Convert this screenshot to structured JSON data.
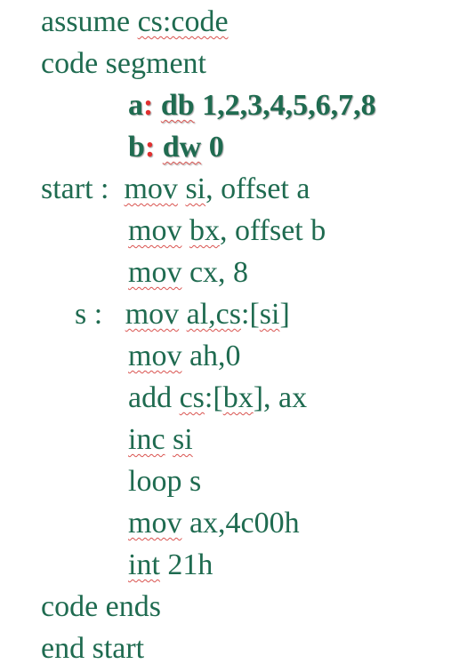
{
  "document": {
    "text_color": "#1f6b50",
    "accent_color": "#e03030",
    "spell_underline_color": "#d9534f",
    "lines": [
      {
        "indent": 46,
        "segments": [
          {
            "text": "assume "
          },
          {
            "text": "cs:code",
            "wavy": true
          }
        ]
      },
      {
        "indent": 46,
        "segments": [
          {
            "text": "code segment"
          }
        ]
      },
      {
        "indent": 144,
        "bold": true,
        "segments": [
          {
            "text": "a"
          },
          {
            "text": ":",
            "red": true
          },
          {
            "text": " "
          },
          {
            "text": "db",
            "wavy": true
          },
          {
            "text": " 1,2,3,4,5,6,7,8"
          }
        ]
      },
      {
        "indent": 144,
        "bold": true,
        "segments": [
          {
            "text": "b"
          },
          {
            "text": ":",
            "red": true
          },
          {
            "text": " "
          },
          {
            "text": "dw",
            "wavy": true
          },
          {
            "text": " 0"
          }
        ]
      },
      {
        "indent": 46,
        "segments": [
          {
            "text": "start :  "
          },
          {
            "text": "mov",
            "wavy": true
          },
          {
            "text": " "
          },
          {
            "text": "si",
            "wavy": true
          },
          {
            "text": ", offset a"
          }
        ]
      },
      {
        "indent": 144,
        "segments": [
          {
            "text": "mov",
            "wavy": true
          },
          {
            "text": " "
          },
          {
            "text": "bx",
            "wavy": true
          },
          {
            "text": ", offset b"
          }
        ]
      },
      {
        "indent": 144,
        "segments": [
          {
            "text": "mov",
            "wavy": true
          },
          {
            "text": " cx, 8"
          }
        ]
      },
      {
        "indent": 84,
        "segments": [
          {
            "text": "s :   "
          },
          {
            "text": "mov",
            "wavy": true
          },
          {
            "text": " "
          },
          {
            "text": "al,cs",
            "wavy": true
          },
          {
            "text": ":["
          },
          {
            "text": "si",
            "wavy": true
          },
          {
            "text": "]"
          }
        ]
      },
      {
        "indent": 144,
        "segments": [
          {
            "text": "mov",
            "wavy": true
          },
          {
            "text": " ah,0"
          }
        ]
      },
      {
        "indent": 144,
        "segments": [
          {
            "text": "add "
          },
          {
            "text": "cs",
            "wavy": true
          },
          {
            "text": ":["
          },
          {
            "text": "bx",
            "wavy": true
          },
          {
            "text": "], ax"
          }
        ]
      },
      {
        "indent": 144,
        "segments": [
          {
            "text": "inc",
            "wavy": true
          },
          {
            "text": " "
          },
          {
            "text": "si",
            "wavy": true
          }
        ]
      },
      {
        "indent": 144,
        "segments": [
          {
            "text": "loop s"
          }
        ]
      },
      {
        "indent": 144,
        "segments": [
          {
            "text": "mov",
            "wavy": true
          },
          {
            "text": " ax,4c00h"
          }
        ]
      },
      {
        "indent": 144,
        "segments": [
          {
            "text": "int",
            "wavy": true
          },
          {
            "text": " 21h"
          }
        ]
      },
      {
        "indent": 46,
        "segments": [
          {
            "text": "code ends"
          }
        ]
      },
      {
        "indent": 46,
        "segments": [
          {
            "text": "end start"
          }
        ]
      }
    ]
  }
}
